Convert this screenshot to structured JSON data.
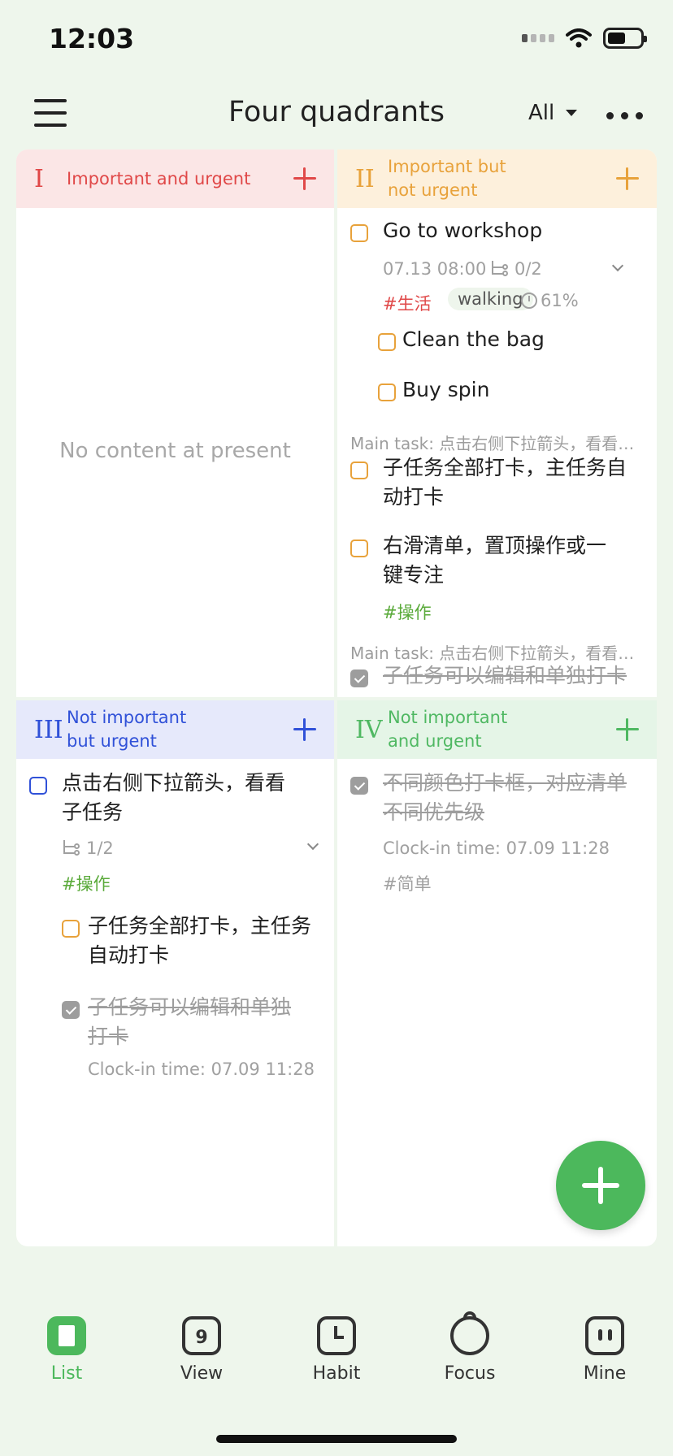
{
  "status_bar": {
    "time": "12:03"
  },
  "nav": {
    "title": "Four quadrants",
    "filter_label": "All"
  },
  "quadrants": {
    "q1": {
      "roman": "I",
      "title": "Important and urgent",
      "empty_text": "No content at present"
    },
    "q2": {
      "roman": "II",
      "title_line1": "Important but",
      "title_line2": "not urgent",
      "task1": {
        "title": "Go to workshop",
        "datetime": "07.13 08:00",
        "subtask_count": "0/2",
        "tag": "#生活",
        "pill": "walking",
        "progress": "61%",
        "sub1": "Clean the bag",
        "sub2": "Buy spin"
      },
      "main_task_1": "Main task: 点击右侧下拉箭头，看看子任务",
      "task2_line1": "子任务全部打卡，主任务自",
      "task2_line2": "动打卡",
      "task3_line1": "右滑清单，置顶操作或一",
      "task3_line2": "键专注",
      "task3_tag": "#操作",
      "main_task_2": "Main task: 点击右侧下拉箭头，看看子任务",
      "task4": "子任务可以编辑和单独打卡"
    },
    "q3": {
      "roman": "III",
      "title_line1": "Not important",
      "title_line2": "but urgent",
      "task1_line1": "点击右侧下拉箭头，看看",
      "task1_line2": "子任务",
      "subtask_count": "1/2",
      "tag": "#操作",
      "sub1_line1": "子任务全部打卡，主任务",
      "sub1_line2": "自动打卡",
      "sub2_line1": "子任务可以编辑和单独",
      "sub2_line2": "打卡",
      "sub2_clock": "Clock-in time: 07.09 11:28"
    },
    "q4": {
      "roman": "IV",
      "title_line1": "Not important",
      "title_line2": "and urgent",
      "task1_line1": "不同颜色打卡框，对应清单",
      "task1_line2": "不同优先级",
      "clock": "Clock-in time: 07.09 11:28",
      "tag": "#简单"
    }
  },
  "tabs": [
    {
      "label": "List",
      "icon": "list-icon"
    },
    {
      "label": "View",
      "icon": "calendar-icon",
      "day": "9"
    },
    {
      "label": "Habit",
      "icon": "clock-icon"
    },
    {
      "label": "Focus",
      "icon": "tomato-icon"
    },
    {
      "label": "Mine",
      "icon": "face-icon"
    }
  ],
  "colors": {
    "q1": "#e04848",
    "q2": "#e8a23b",
    "q3": "#3051d8",
    "q4": "#4fb862",
    "accent": "#4cb85c"
  }
}
